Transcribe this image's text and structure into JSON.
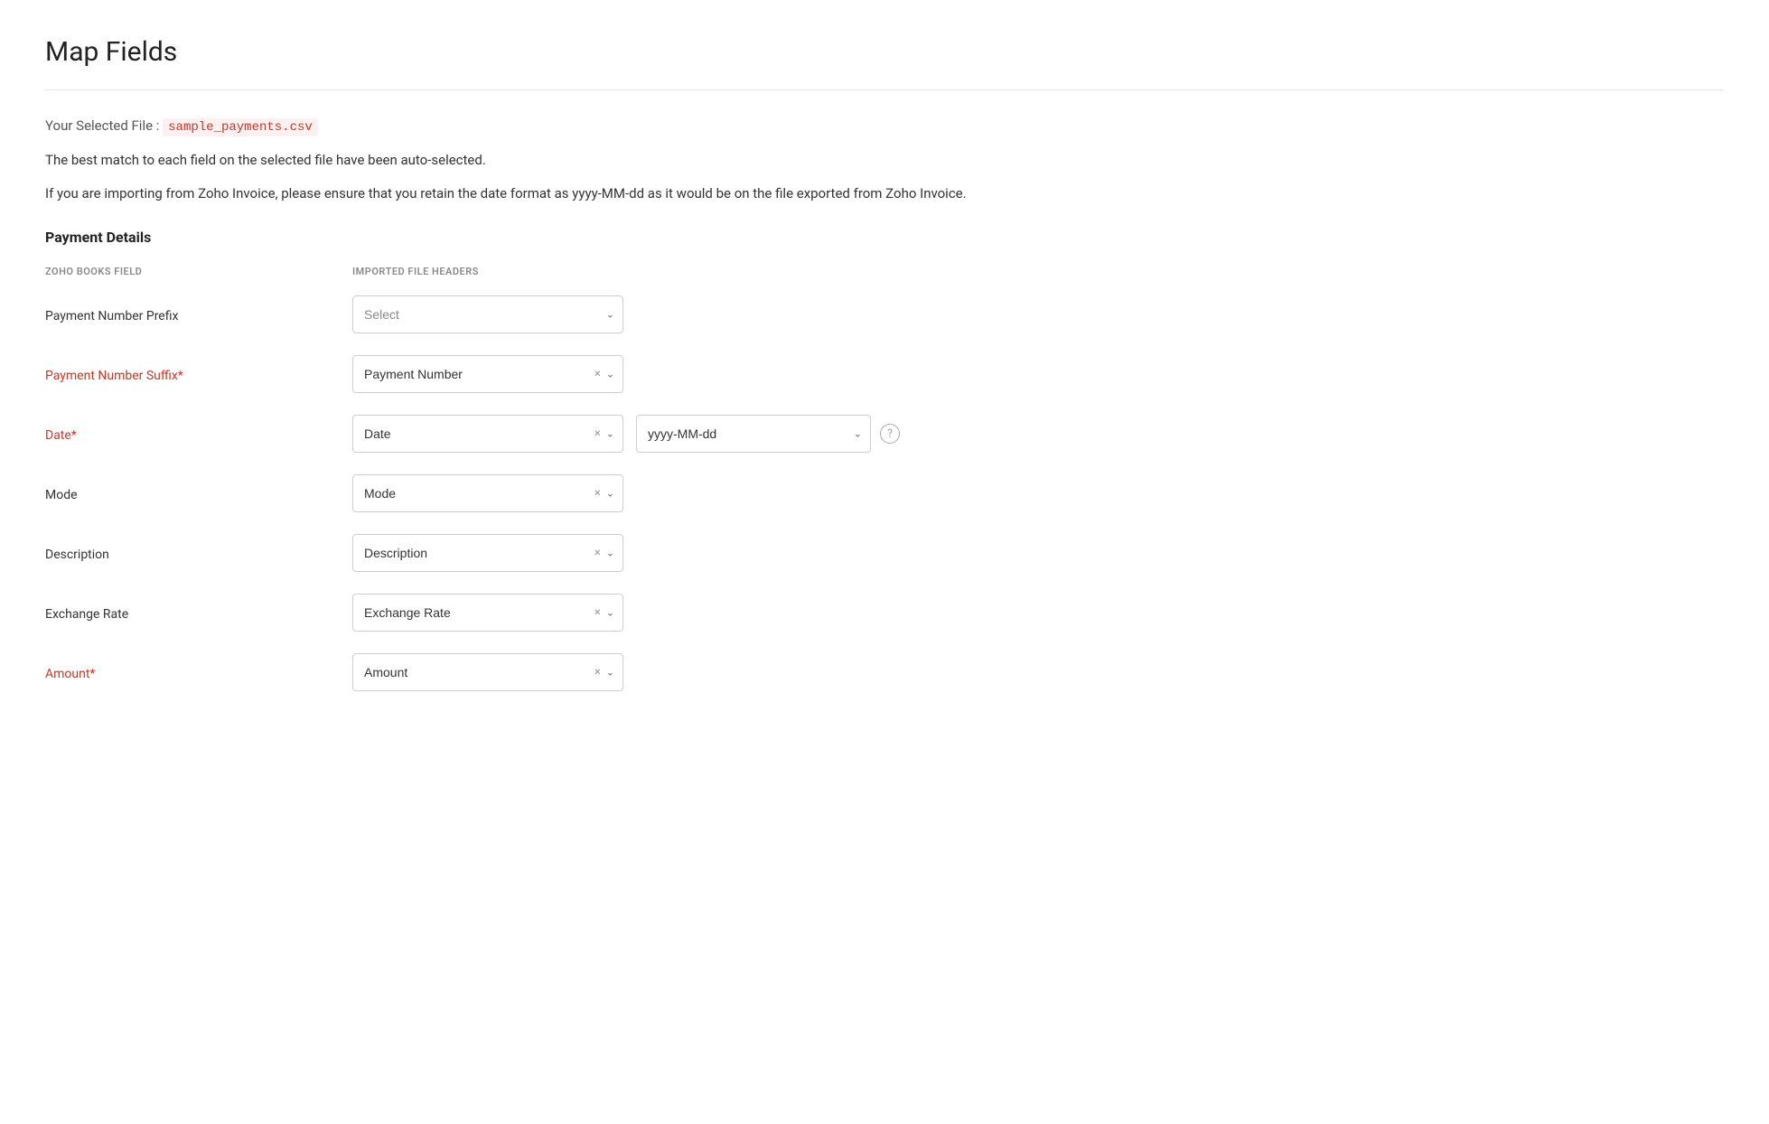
{
  "page": {
    "title": "Map Fields",
    "file_label": "Your Selected File :",
    "file_name": "sample_payments.csv",
    "info_text_1": "The best match to each field on the selected file have been auto-selected.",
    "info_text_2": "If you are importing from Zoho Invoice, please ensure that you retain the date format as yyyy-MM-dd as it would be on the file exported from Zoho Invoice.",
    "section_title": "Payment Details",
    "col_books_field": "ZOHO BOOKS FIELD",
    "col_imported_headers": "IMPORTED FILE HEADERS"
  },
  "fields": [
    {
      "name": "Payment Number Prefix",
      "required": false,
      "selected_value": "",
      "placeholder": "Select",
      "show_clear": false,
      "show_date_format": false,
      "date_format_value": ""
    },
    {
      "name": "Payment Number Suffix*",
      "required": true,
      "selected_value": "Payment Number",
      "placeholder": "Select",
      "show_clear": true,
      "show_date_format": false,
      "date_format_value": ""
    },
    {
      "name": "Date*",
      "required": true,
      "selected_value": "Date",
      "placeholder": "Select",
      "show_clear": true,
      "show_date_format": true,
      "date_format_value": "yyyy-MM-dd"
    },
    {
      "name": "Mode",
      "required": false,
      "selected_value": "Mode",
      "placeholder": "Select",
      "show_clear": true,
      "show_date_format": false,
      "date_format_value": ""
    },
    {
      "name": "Description",
      "required": false,
      "selected_value": "Description",
      "placeholder": "Select",
      "show_clear": true,
      "show_date_format": false,
      "date_format_value": ""
    },
    {
      "name": "Exchange Rate",
      "required": false,
      "selected_value": "Exchange Rate",
      "placeholder": "Select",
      "show_clear": true,
      "show_date_format": false,
      "date_format_value": ""
    },
    {
      "name": "Amount*",
      "required": true,
      "selected_value": "Amount",
      "placeholder": "Select",
      "show_clear": true,
      "show_date_format": false,
      "date_format_value": ""
    }
  ]
}
